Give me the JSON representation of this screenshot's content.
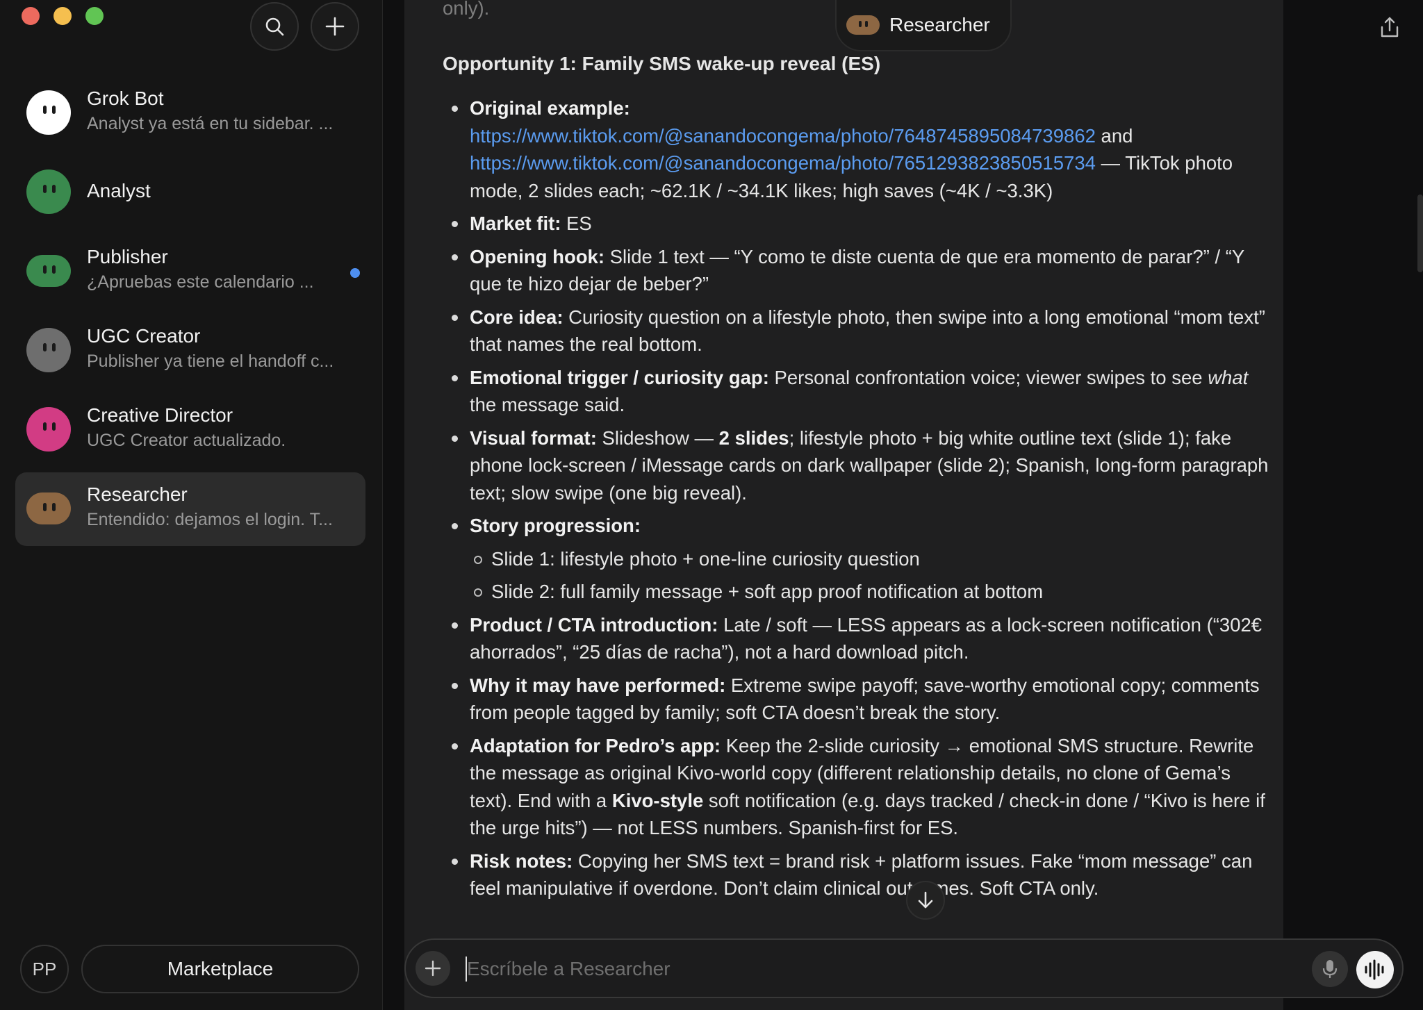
{
  "sidebar": {
    "agents": [
      {
        "name": "Grok Bot",
        "preview": "Analyst ya está en tu sidebar. ...",
        "color": "#ffffff",
        "shape": "circle",
        "unread": false,
        "active": false
      },
      {
        "name": "Analyst",
        "preview": "",
        "color": "#3a8a4e",
        "shape": "circle",
        "unread": false,
        "active": false
      },
      {
        "name": "Publisher",
        "preview": "¿Apruebas este calendario ...",
        "color": "#3a8a4e",
        "shape": "pill",
        "unread": true,
        "active": false
      },
      {
        "name": "UGC Creator",
        "preview": "Publisher ya tiene el handoff c...",
        "color": "#6e6e6e",
        "shape": "circle",
        "unread": false,
        "active": false
      },
      {
        "name": "Creative Director",
        "preview": "UGC Creator actualizado.",
        "color": "#d23c84",
        "shape": "circle",
        "unread": false,
        "active": false
      },
      {
        "name": "Researcher",
        "preview": "Entendido: dejamos el login. T...",
        "color": "#8d6743",
        "shape": "pill",
        "unread": false,
        "active": true
      }
    ],
    "user_initials": "PP",
    "marketplace_label": "Marketplace"
  },
  "header": {
    "agent_name": "Researcher"
  },
  "message": {
    "faded_line": "only).",
    "heading": "Opportunity 1: Family SMS wake-up reveal (ES)",
    "original_example": {
      "label": "Original example:",
      "link1": "https://www.tiktok.com/@sanandocongema/photo/7648745895084739862",
      "and": " and ",
      "link2": "https://www.tiktok.com/@sanandocongema/photo/7651293823850515734",
      "rest": " — TikTok photo mode, 2 slides each; ~62.1K / ~34.1K likes; high saves (~4K / ~3.3K)"
    },
    "market_fit": {
      "label": "Market fit:",
      "text": " ES"
    },
    "opening_hook": {
      "label": "Opening hook:",
      "text": " Slide 1 text — “Y como te diste cuenta de que era momento de parar?” / “Y que te hizo dejar de beber?”"
    },
    "core_idea": {
      "label": "Core idea:",
      "text": " Curiosity question on a lifestyle photo, then swipe into a long emotional “mom text” that names the real bottom."
    },
    "emotional_trigger": {
      "label": "Emotional trigger / curiosity gap:",
      "text": " Personal confrontation voice; viewer swipes to see ",
      "italic": "what",
      "text2": " the message said."
    },
    "visual_format": {
      "label": "Visual format:",
      "text": " Slideshow — ",
      "bold": "2 slides",
      "text2": "; lifestyle photo + big white outline text (slide 1); fake phone lock-screen / iMessage cards on dark wallpaper (slide 2); Spanish, long-form paragraph text; slow swipe (one big reveal)."
    },
    "story_progression": {
      "label": "Story progression:",
      "items": [
        "Slide 1: lifestyle photo + one-line curiosity question",
        "Slide 2: full family message + soft app proof notification at bottom"
      ]
    },
    "product_cta": {
      "label": "Product / CTA introduction:",
      "text": " Late / soft — LESS appears as a lock-screen notification (“302€ ahorrados”, “25 días de racha”), not a hard download pitch."
    },
    "why_performed": {
      "label": "Why it may have performed:",
      "text": " Extreme swipe payoff; save-worthy emotional copy; comments from people tagged by family; soft CTA doesn’t break the story."
    },
    "adaptation": {
      "label": "Adaptation for Pedro’s app:",
      "text": " Keep the 2-slide curiosity → emotional SMS structure. Rewrite the message as original Kivo-world copy (different relationship details, no clone of Gema’s text). End with a ",
      "bold": "Kivo-style",
      "text2": " soft notification (e.g. days tracked / check-in done / “Kivo is here if the urge hits”) — not LESS numbers. Spanish-first for ES."
    },
    "risk_notes": {
      "label": "Risk notes:",
      "text": " Copying her SMS text = brand risk + platform issues. Fake “mom message” can feel manipulative if overdone. Don’t claim clinical outcomes. Soft CTA only."
    }
  },
  "composer": {
    "placeholder": "Escríbele a Researcher"
  },
  "colors": {
    "link": "#5b9cf0",
    "unread_dot": "#4e8ff0",
    "researcher_avatar": "#8d6743"
  }
}
